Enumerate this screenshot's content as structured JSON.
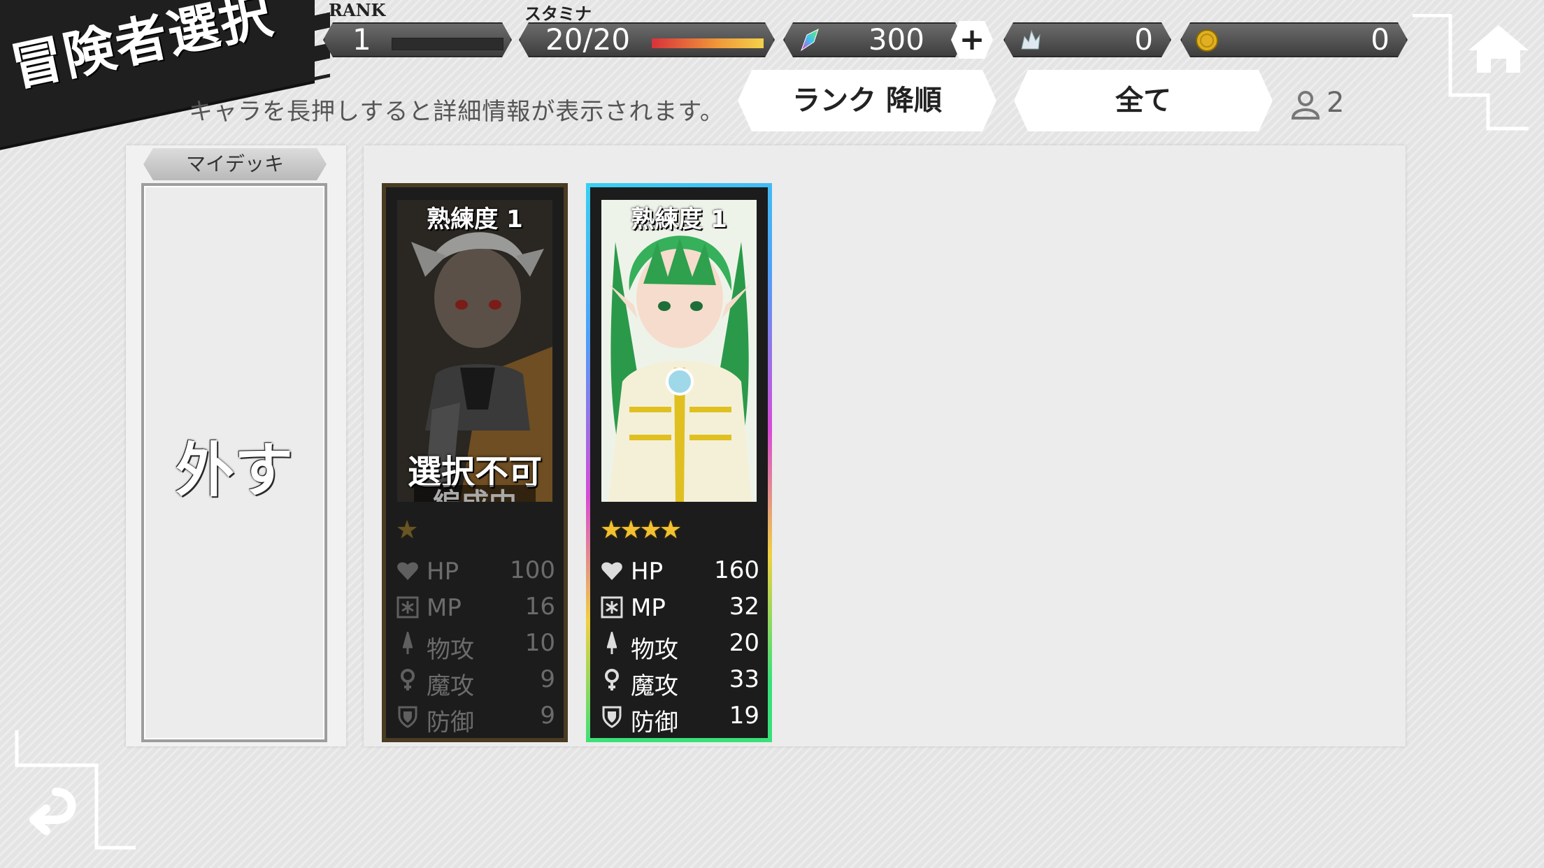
{
  "header": {
    "title": "冒険者選択",
    "rank_label": "RANK",
    "rank_value": "1",
    "stamina_label": "スタミナ",
    "stamina_value": "20/20",
    "stamina_fraction": 1.0,
    "gems": "300",
    "gem_plus_label": "+",
    "crystals": "0",
    "coins": "0"
  },
  "hint_text": "キャラを長押しすると詳細情報が表示されます。",
  "sort_button_label": "ランク 降順",
  "filter_button_label": "全て",
  "character_count": "2",
  "deck": {
    "tab_label": "マイデッキ",
    "remove_label": "外す"
  },
  "cards": [
    {
      "proficiency": "熟練度 1",
      "stars": "★",
      "star_count": 1,
      "status_main": "選択不可",
      "status_sub": "編成中",
      "stats": [
        {
          "label": "HP",
          "value": "100"
        },
        {
          "label": "MP",
          "value": "16"
        },
        {
          "label": "物攻",
          "value": "10"
        },
        {
          "label": "魔攻",
          "value": "9"
        },
        {
          "label": "防御",
          "value": "9"
        }
      ]
    },
    {
      "proficiency": "熟練度 1",
      "stars": "★★★★",
      "star_count": 4,
      "stats": [
        {
          "label": "HP",
          "value": "160"
        },
        {
          "label": "MP",
          "value": "32"
        },
        {
          "label": "物攻",
          "value": "20"
        },
        {
          "label": "魔攻",
          "value": "33"
        },
        {
          "label": "防御",
          "value": "19"
        }
      ]
    }
  ],
  "colors": {
    "title_ribbon": "#1f1f1f",
    "stars": "#f2c030",
    "stamina_gauge": "#e04040"
  },
  "icons": [
    "home-icon",
    "back-icon",
    "gem-icon",
    "crystal-icon",
    "coin-icon",
    "person-icon",
    "heart-icon",
    "mp-icon",
    "sword-icon",
    "magic-icon",
    "shield-icon"
  ]
}
